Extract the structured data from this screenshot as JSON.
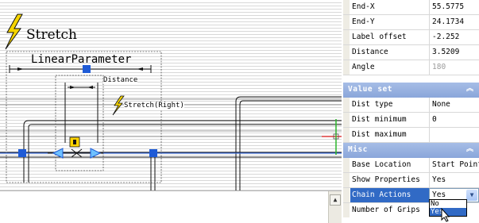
{
  "drawing": {
    "stretch_title": "Stretch",
    "linear_parameter_label": "LinearParameter",
    "distance_label": "Distance",
    "stretch_action_label": "Stretch(Right)"
  },
  "properties": {
    "rows_top": [
      {
        "key": "End-X",
        "value": "55.5775"
      },
      {
        "key": "End-Y",
        "value": "24.1734"
      },
      {
        "key": "Label offset",
        "value": "-2.252"
      },
      {
        "key": "Distance",
        "value": "3.5209"
      },
      {
        "key": "Angle",
        "value": "180"
      }
    ],
    "value_set": {
      "title": "Value set",
      "rows": [
        {
          "key": "Dist type",
          "value": "None"
        },
        {
          "key": "Dist minimum",
          "value": "0"
        },
        {
          "key": "Dist maximum",
          "value": ""
        }
      ]
    },
    "misc": {
      "title": "Misc",
      "rows": [
        {
          "key": "Base Location",
          "value": "Start Point"
        },
        {
          "key": "Show Properties",
          "value": "Yes"
        }
      ],
      "chain_actions": {
        "key": "Chain Actions",
        "value": "Yes"
      },
      "number_of_grips": {
        "key": "Number of Grips"
      }
    }
  },
  "dropdown_options": [
    "No",
    "Yes"
  ],
  "colors": {
    "section_header": "#8aa6da",
    "selection": "#316ac5",
    "grip": "#1f5bd6",
    "dimension_line": "#3a6ad6"
  }
}
